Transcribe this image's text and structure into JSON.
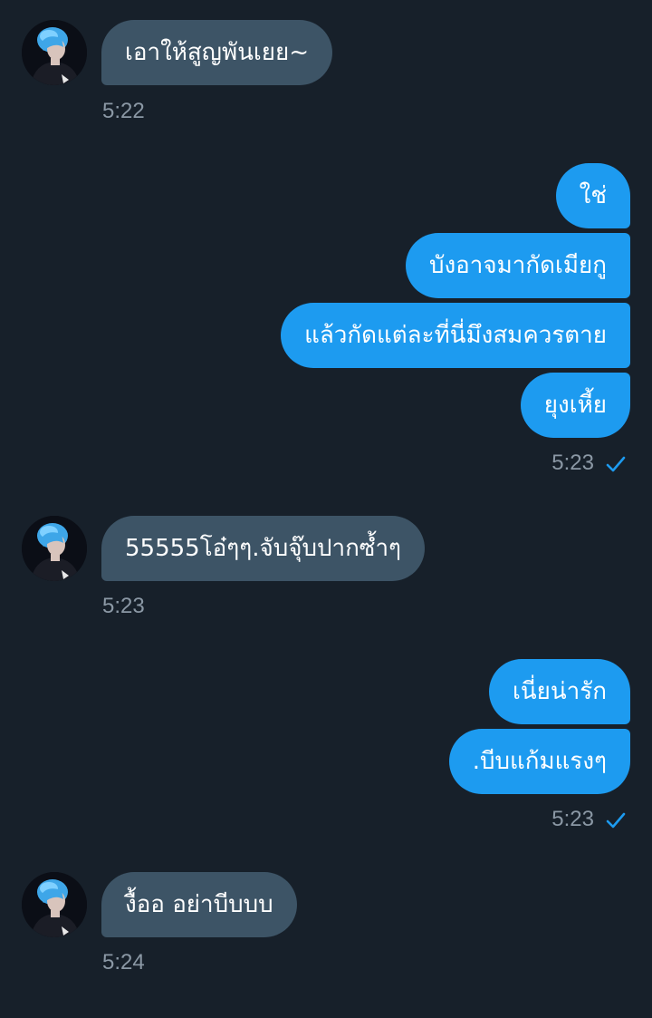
{
  "messages": [
    {
      "direction": "in",
      "text": "เอาให้สูญพันเยย~",
      "time": "5:22"
    },
    {
      "direction": "out",
      "texts": [
        "ใช่",
        "บังอาจมากัดเมียกู",
        "แล้วกัดแต่ละที่นี่มึงสมควรตาย",
        "ยุงเหี้ย"
      ],
      "time": "5:23",
      "status": "sent"
    },
    {
      "direction": "in",
      "text": "55555โอ๋ๆๆ.จับจุ๊บปากซ้ำๆ",
      "time": "5:23"
    },
    {
      "direction": "out",
      "texts": [
        "เนี่ยน่ารัก",
        ".บีบแก้มแรงๆ"
      ],
      "time": "5:23",
      "status": "sent"
    },
    {
      "direction": "in",
      "text": "งื้ออ อย่าบีบบบ",
      "time": "5:24"
    }
  ],
  "icons": {
    "status": "checkmark-icon",
    "avatar": "contact-avatar"
  },
  "colors": {
    "background": "#17202a",
    "incoming_bubble": "#3d5466",
    "outgoing_bubble": "#1d9bf0",
    "timestamp": "#8b98a5",
    "check": "#1d9bf0"
  }
}
